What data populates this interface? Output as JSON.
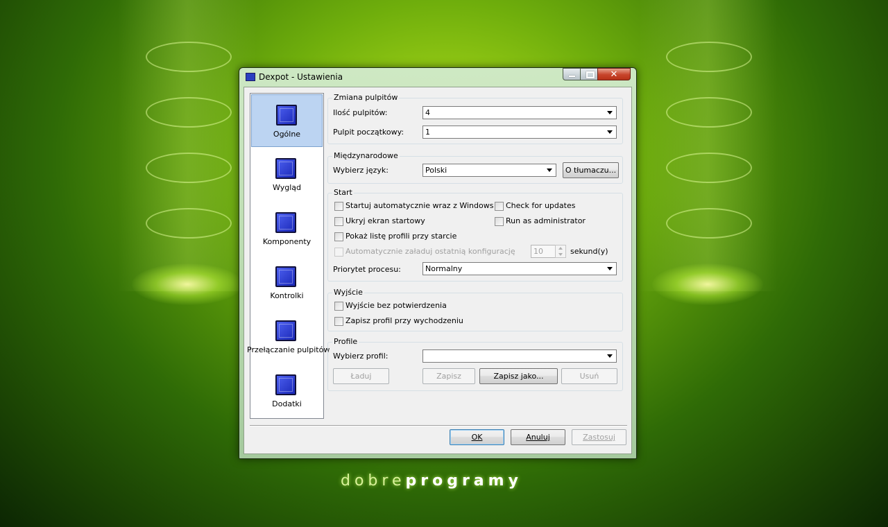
{
  "window": {
    "title": "Dexpot - Ustawienia",
    "close_glyph": "✕"
  },
  "wallpaper": {
    "brand_light": "dobre",
    "brand_bold": "programy"
  },
  "sidebar": {
    "items": [
      {
        "label": "Ogólne",
        "icon": "general-icon",
        "selected": true
      },
      {
        "label": "Wygląd",
        "icon": "appearance-icon",
        "selected": false
      },
      {
        "label": "Komponenty",
        "icon": "components-icon",
        "selected": false
      },
      {
        "label": "Kontrolki",
        "icon": "controls-icon",
        "selected": false
      },
      {
        "label": "Przełączanie pulpitów",
        "icon": "switching-icon",
        "selected": false
      },
      {
        "label": "Dodatki",
        "icon": "plugins-icon",
        "selected": false
      }
    ]
  },
  "desktop_change": {
    "legend": "Zmiana pulpitów",
    "count_label": "Ilość pulpitów:",
    "count_value": "4",
    "start_label": "Pulpit początkowy:",
    "start_value": "1"
  },
  "international": {
    "legend": "Międzynarodowe",
    "language_label": "Wybierz język:",
    "language_value": "Polski",
    "translators_button": "O tłumaczu..."
  },
  "start": {
    "legend": "Start",
    "autostart_label": "Startuj automatycznie wraz z Windows",
    "autostart_checked": false,
    "splash_label": "Ukryj ekran startowy",
    "splash_checked": false,
    "profiles_label": "Pokaż listę profili przy starcie",
    "profiles_checked": false,
    "autoload_label": "Automatycznie załaduj ostatnią konfigurację",
    "autoload_checked": false,
    "autoload_seconds": "10",
    "seconds_label": "sekund(y)",
    "updates_label": "Check for updates",
    "updates_checked": false,
    "admin_label": "Run as administrator",
    "admin_checked": false,
    "priority_label": "Priorytet procesu:",
    "priority_value": "Normalny"
  },
  "exit": {
    "legend": "Wyjście",
    "no_confirm_label": "Wyjście bez potwierdzenia",
    "no_confirm_checked": false,
    "save_profile_label": "Zapisz profil przy wychodzeniu",
    "save_profile_checked": false
  },
  "profiles": {
    "legend": "Profile",
    "select_label": "Wybierz profil:",
    "select_value": "",
    "load_button": "Ładuj",
    "save_button": "Zapisz",
    "save_as_button": "Zapisz jako...",
    "delete_button": "Usuń"
  },
  "dialog": {
    "ok": "OK",
    "cancel": "Anuluj",
    "apply": "Zastosuj"
  }
}
